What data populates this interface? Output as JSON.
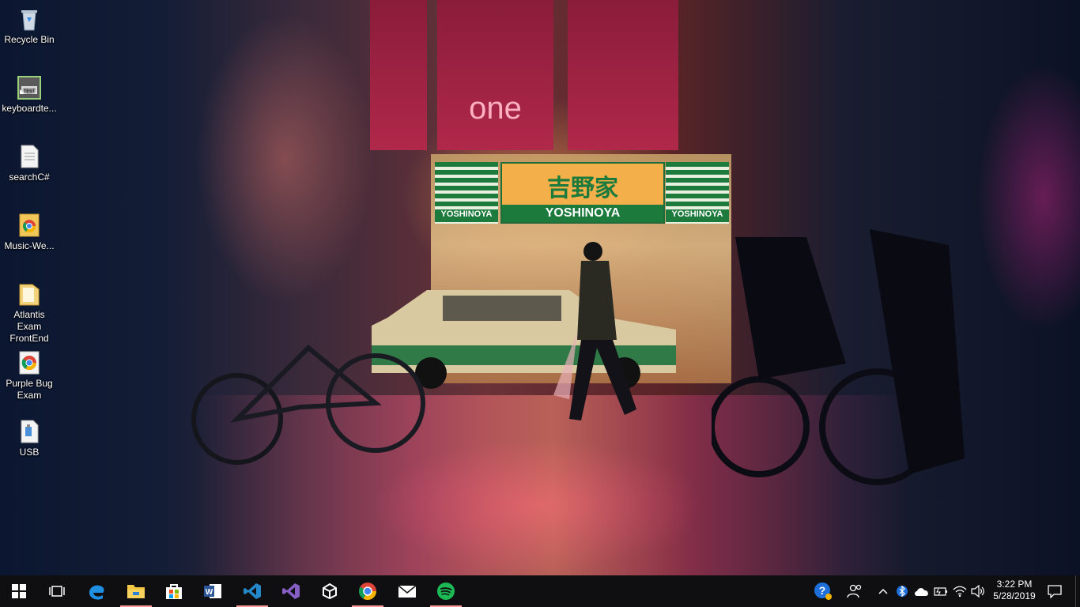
{
  "desktop": {
    "icons": [
      {
        "label": "Recycle Bin",
        "icon": "recycle-bin-icon"
      },
      {
        "label": "keyboardte...",
        "icon": "text-shortcut-icon"
      },
      {
        "label": "searchC#",
        "icon": "document-icon"
      },
      {
        "label": "Music-We...",
        "icon": "chrome-shortcut-icon"
      },
      {
        "label": "Atlantis Exam FrontEnd",
        "icon": "folder-icon"
      },
      {
        "label": "Purple Bug Exam",
        "icon": "chrome-shortcut-icon"
      },
      {
        "label": "USB",
        "icon": "usb-file-icon"
      }
    ],
    "wallpaper": {
      "sign_jp": "吉野家",
      "sign_en": "YOSHINOYA",
      "sign_side": "YOSHINOYA",
      "banner_text": "one"
    }
  },
  "taskbar": {
    "apps": [
      {
        "name": "start",
        "icon": "windows-start-icon"
      },
      {
        "name": "task-view",
        "icon": "task-view-icon"
      },
      {
        "name": "edge",
        "icon": "edge-icon"
      },
      {
        "name": "file-explorer",
        "icon": "folder-icon",
        "running": true
      },
      {
        "name": "store",
        "icon": "store-icon"
      },
      {
        "name": "word",
        "icon": "word-icon"
      },
      {
        "name": "vscode",
        "icon": "vscode-icon",
        "running": true
      },
      {
        "name": "visual-studio",
        "icon": "visual-studio-icon"
      },
      {
        "name": "unity",
        "icon": "unity-icon"
      },
      {
        "name": "chrome",
        "icon": "chrome-icon",
        "running": true
      },
      {
        "name": "mail",
        "icon": "mail-icon"
      },
      {
        "name": "spotify",
        "icon": "spotify-icon",
        "running": true
      }
    ],
    "tray": {
      "time": "3:22 PM",
      "date": "5/28/2019"
    },
    "colors": {
      "taskbar_bg": "#0f0f12",
      "running_indicator": "#ff9a9a"
    }
  }
}
